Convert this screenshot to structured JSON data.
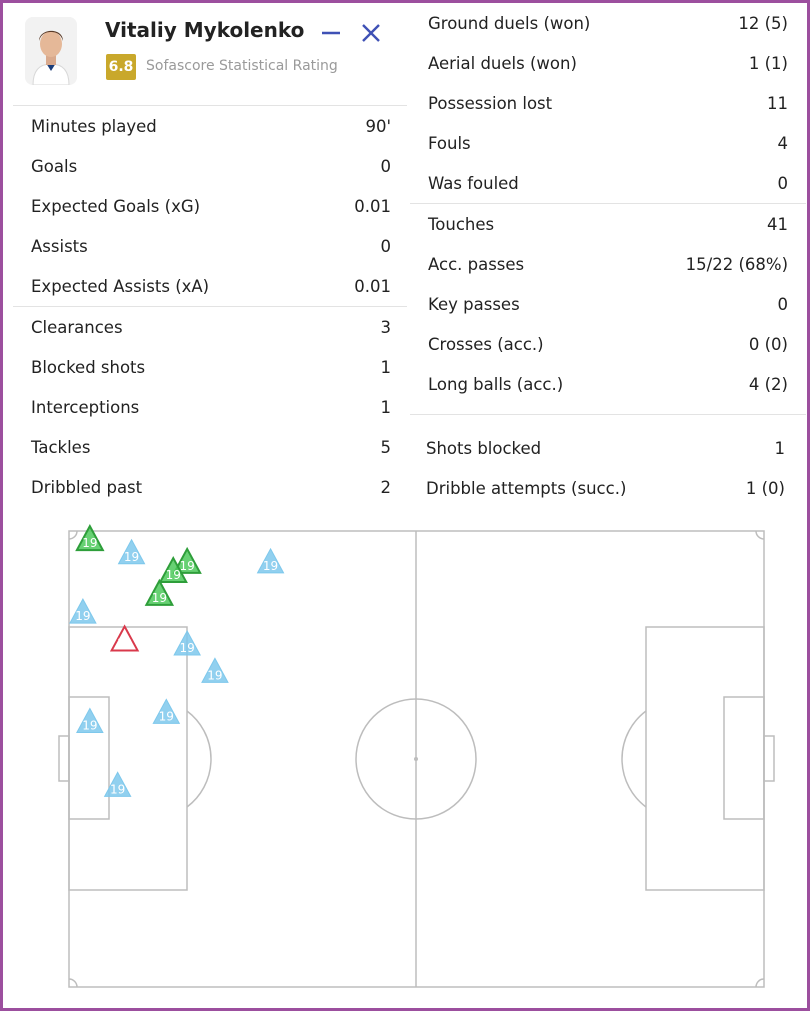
{
  "player": {
    "name": "Vitaliy Mykolenko",
    "rating": "6.8",
    "rating_label": "Sofascore Statistical Rating"
  },
  "colors": {
    "rating_badge": "#c9a82b",
    "accent_icon": "#3f51b5",
    "frame": "#9c4f9e",
    "marker_blue": "#7ec8ec",
    "marker_green": "#4cc95a",
    "marker_red": "#d9394b",
    "pitch_lines": "#bdbdbd"
  },
  "icons": {
    "minimize": "minimize-icon",
    "close": "close-icon"
  },
  "left_groups": [
    [
      {
        "label": "Minutes played",
        "value": "90'"
      },
      {
        "label": "Goals",
        "value": "0"
      },
      {
        "label": "Expected Goals (xG)",
        "value": "0.01"
      },
      {
        "label": "Assists",
        "value": "0"
      },
      {
        "label": "Expected Assists (xA)",
        "value": "0.01"
      }
    ],
    [
      {
        "label": "Clearances",
        "value": "3"
      },
      {
        "label": "Blocked shots",
        "value": "1"
      },
      {
        "label": "Interceptions",
        "value": "1"
      },
      {
        "label": "Tackles",
        "value": "5"
      },
      {
        "label": "Dribbled past",
        "value": "2"
      }
    ]
  ],
  "right_groups": [
    [
      {
        "label": "Ground duels (won)",
        "value": "12 (5)"
      },
      {
        "label": "Aerial duels (won)",
        "value": "1 (1)"
      },
      {
        "label": "Possession lost",
        "value": "11"
      },
      {
        "label": "Fouls",
        "value": "4"
      },
      {
        "label": "Was fouled",
        "value": "0"
      }
    ],
    [
      {
        "label": "Touches",
        "value": "41"
      },
      {
        "label": "Acc. passes",
        "value": "15/22 (68%)"
      },
      {
        "label": "Key passes",
        "value": "0"
      },
      {
        "label": "Crosses (acc.)",
        "value": "0 (0)"
      },
      {
        "label": "Long balls (acc.)",
        "value": "4 (2)"
      }
    ],
    [
      {
        "label": "Shots blocked",
        "value": "1"
      },
      {
        "label": "Dribble attempts (succ.)",
        "value": "1 (0)"
      }
    ]
  ],
  "heatmap": {
    "marker_label": "19",
    "markers": [
      {
        "x": 3,
        "y": 2,
        "type": "green"
      },
      {
        "x": 9,
        "y": 5,
        "type": "blue"
      },
      {
        "x": 17,
        "y": 7,
        "type": "green"
      },
      {
        "x": 15,
        "y": 9,
        "type": "green"
      },
      {
        "x": 13,
        "y": 14,
        "type": "green"
      },
      {
        "x": 29,
        "y": 7,
        "type": "blue"
      },
      {
        "x": 2,
        "y": 18,
        "type": "blue"
      },
      {
        "x": 8,
        "y": 24,
        "type": "red"
      },
      {
        "x": 17,
        "y": 25,
        "type": "blue"
      },
      {
        "x": 21,
        "y": 31,
        "type": "blue"
      },
      {
        "x": 3,
        "y": 42,
        "type": "blue"
      },
      {
        "x": 14,
        "y": 40,
        "type": "blue"
      },
      {
        "x": 7,
        "y": 56,
        "type": "blue"
      }
    ]
  }
}
